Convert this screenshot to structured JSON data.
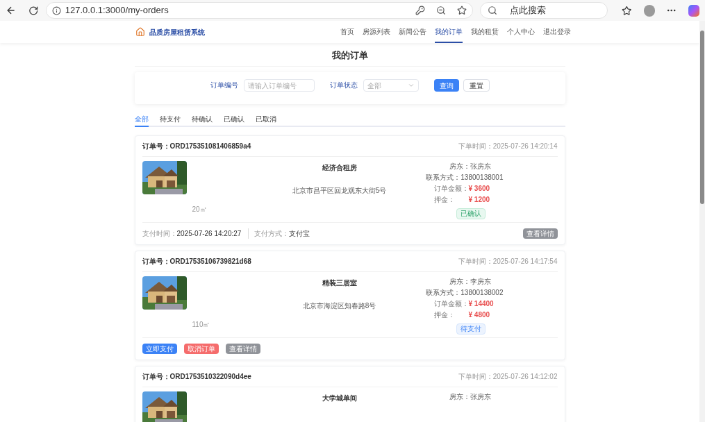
{
  "browser": {
    "url": "127.0.0.1:3000/my-orders",
    "search_placeholder": "点此搜索"
  },
  "nav": {
    "brand": "品质房屋租赁系统",
    "items": [
      {
        "label": "首页",
        "selected": false
      },
      {
        "label": "房源列表",
        "selected": false
      },
      {
        "label": "新闻公告",
        "selected": false
      },
      {
        "label": "我的订单",
        "selected": true
      },
      {
        "label": "我的租赁",
        "selected": false
      },
      {
        "label": "个人中心",
        "selected": false
      },
      {
        "label": "退出登录",
        "selected": false
      }
    ]
  },
  "page_title": "我的订单",
  "filter": {
    "order_no_label": "订单编号",
    "order_no_placeholder": "请输入订单编号",
    "status_label": "订单状态",
    "status_value": "全部",
    "buttons": [
      {
        "label": "查询",
        "kind": "primary"
      },
      {
        "label": "重置",
        "kind": "plain"
      }
    ]
  },
  "tabs": [
    {
      "label": "全部",
      "selected": true
    },
    {
      "label": "待支付",
      "selected": false
    },
    {
      "label": "待确认",
      "selected": false
    },
    {
      "label": "已确认",
      "selected": false
    },
    {
      "label": "已取消",
      "selected": false
    }
  ],
  "orders": [
    {
      "order_no_label": "订单号：",
      "order_no": "ORD175351081406859a4",
      "time_label": "下单时间：",
      "time": "2025-07-26 14:20:14",
      "title": "经济合租房",
      "address": "北京市昌平区回龙观东大街5号",
      "area": "20㎡",
      "landlord_label": "房东：",
      "landlord": "张房东",
      "contact_label": "联系方式：",
      "contact": "13800138001",
      "amount_label": "订单金额：",
      "amount": "¥ 3600",
      "deposit_label": "押金：",
      "deposit": "¥ 1200",
      "status": {
        "label": "已确认",
        "kind": "confirmed"
      },
      "footer": [
        {
          "kind": "info",
          "label": "支付时间：",
          "value": "2025-07-26 14:20:27"
        },
        {
          "kind": "info",
          "label": "支付方式：",
          "value": "支付宝"
        },
        {
          "kind": "secondary",
          "label": "查看详情"
        }
      ]
    },
    {
      "order_no_label": "订单号：",
      "order_no": "ORD17535106739821d68",
      "time_label": "下单时间：",
      "time": "2025-07-26 14:17:54",
      "title": "精装三居室",
      "address": "北京市海淀区知春路8号",
      "area": "110㎡",
      "landlord_label": "房东：",
      "landlord": "李房东",
      "contact_label": "联系方式：",
      "contact": "13800138002",
      "amount_label": "订单金额：",
      "amount": "¥ 14400",
      "deposit_label": "押金：",
      "deposit": "¥ 4800",
      "status": {
        "label": "待支付",
        "kind": "pending"
      },
      "footer": [
        {
          "kind": "primary",
          "label": "立即支付"
        },
        {
          "kind": "danger",
          "label": "取消订单"
        },
        {
          "kind": "secondary",
          "label": "查看详情"
        }
      ]
    },
    {
      "order_no_label": "订单号：",
      "order_no": "ORD1753510322090d4ee",
      "time_label": "下单时间：",
      "time": "2025-07-26 14:12:02",
      "title": "大学城单间",
      "landlord_label": "房东：",
      "landlord": "张房东"
    }
  ]
}
